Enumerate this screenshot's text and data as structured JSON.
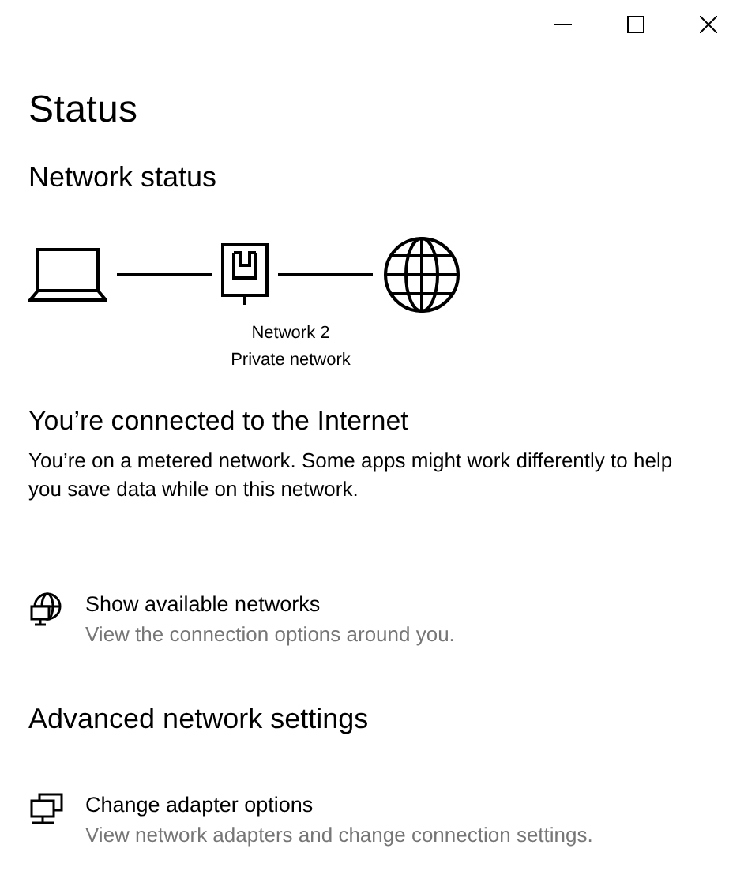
{
  "window": {
    "title": "Status"
  },
  "network_status": {
    "heading": "Network status",
    "network_name": "Network 2",
    "network_type": "Private network"
  },
  "connection": {
    "heading": "You’re connected to the Internet",
    "description": "You’re on a metered network. Some apps might work differently to help you save data while on this network."
  },
  "links": [
    {
      "kind": "networks",
      "title": "Show available networks",
      "subtitle": "View the connection options around you."
    }
  ],
  "advanced": {
    "heading": "Advanced network settings",
    "links": [
      {
        "kind": "adapters",
        "title": "Change adapter options",
        "subtitle": "View network adapters and change connection settings."
      }
    ]
  }
}
